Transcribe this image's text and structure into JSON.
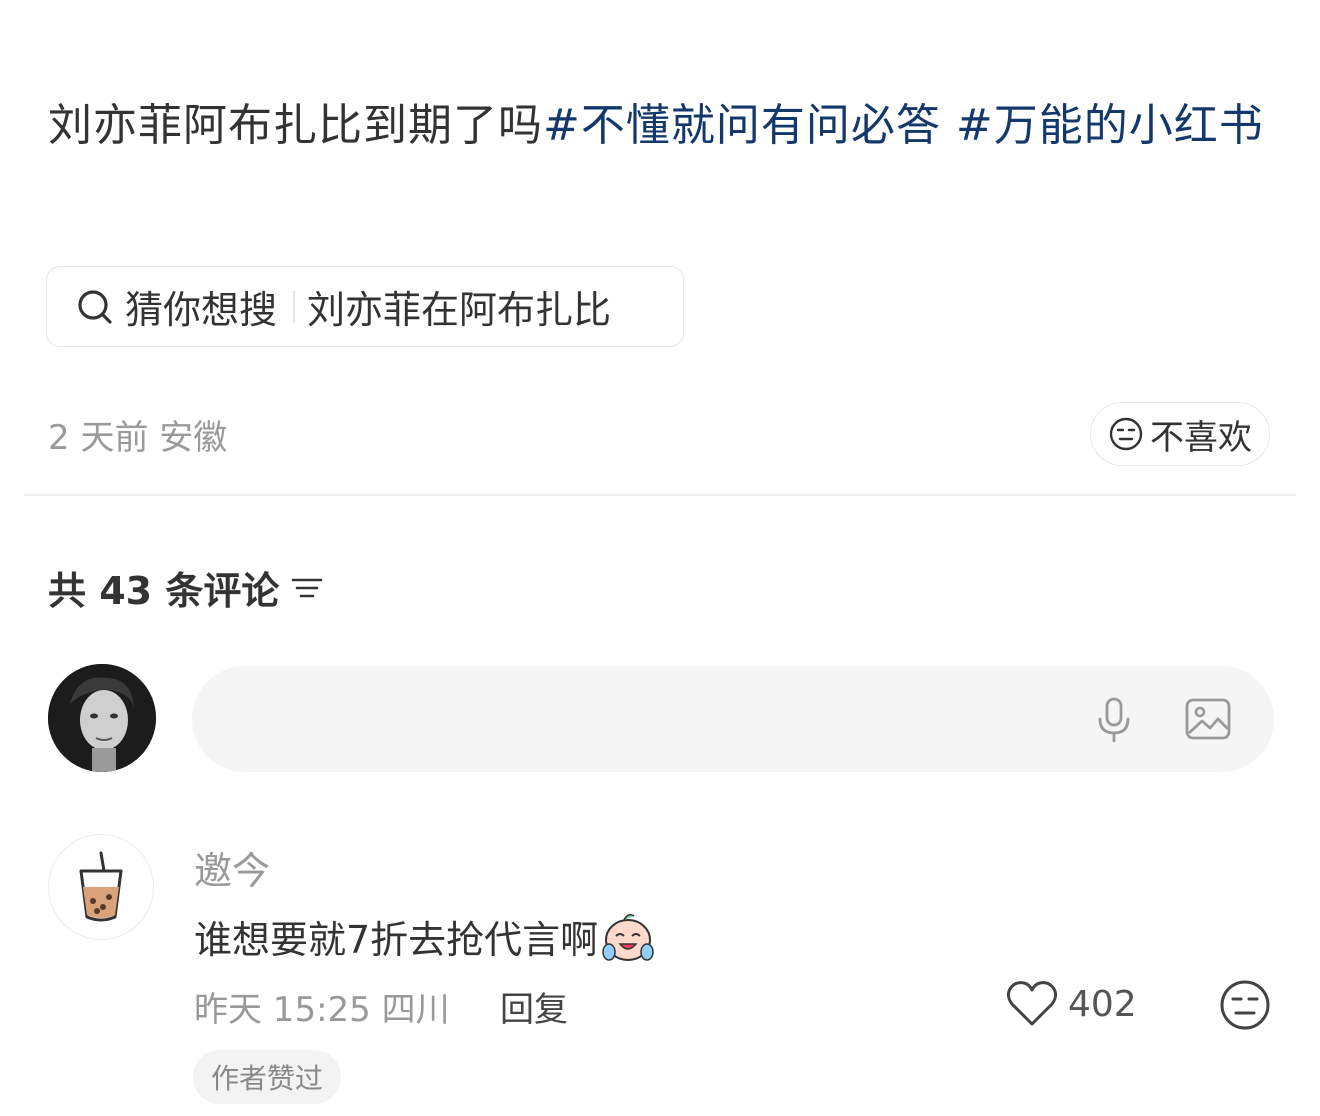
{
  "post": {
    "title_text": "刘亦菲阿布扎比到期了吗",
    "hashtags": [
      "#不懂就问有问必答",
      "#万能的小红书"
    ]
  },
  "search_suggestion": {
    "label": "猜你想搜",
    "query": "刘亦菲在阿布扎比",
    "icon": "search-icon"
  },
  "meta": {
    "time_location": "2 天前 安徽"
  },
  "dislike_button": {
    "label": "不喜欢",
    "icon": "meh-face-icon"
  },
  "comments_header": {
    "count_text": "共 43 条评论",
    "icon": "sort-icon"
  },
  "comment_input": {
    "icons": [
      "microphone-icon",
      "image-icon"
    ]
  },
  "comments": [
    {
      "author": "邀今",
      "text": "谁想要就7折去抢代言啊",
      "time_location": "昨天 15:25 四川",
      "reply_label": "回复",
      "like_count": "402",
      "badge": "作者赞过"
    }
  ],
  "colors": {
    "hashtag": "#13386c",
    "secondary_text": "#999999",
    "input_bg": "#f5f5f5"
  }
}
